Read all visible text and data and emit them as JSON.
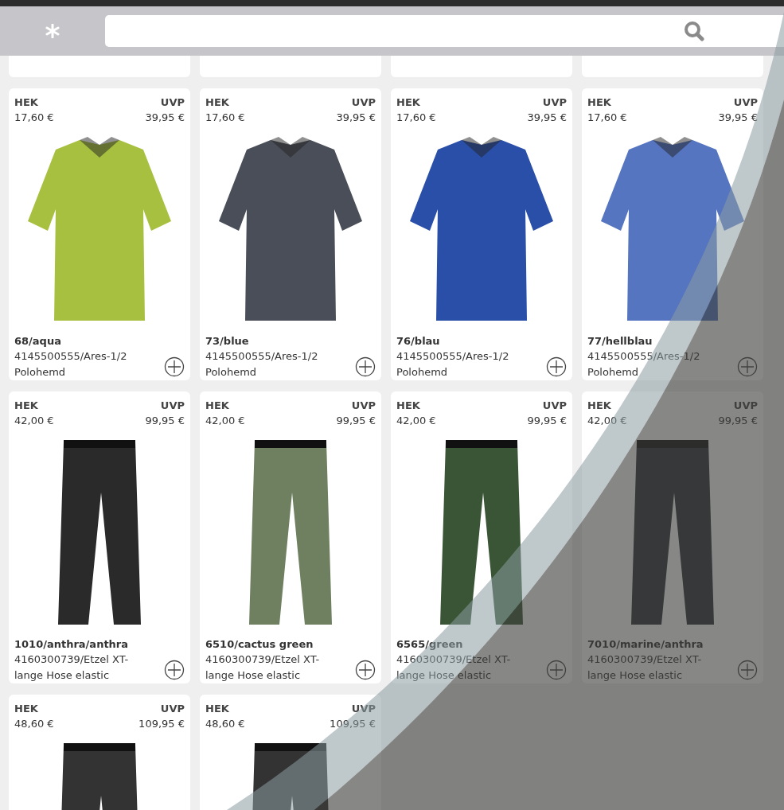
{
  "products": [
    {
      "kind": "partial"
    },
    {
      "kind": "partial"
    },
    {
      "kind": "partial"
    },
    {
      "kind": "partial"
    },
    {
      "kind": "shirt",
      "color": "#a8c040",
      "hek_label": "HEK",
      "hek": "17,60 €",
      "uvp_label": "UVP",
      "uvp": "39,95 €",
      "variant": "68/aqua",
      "model": "4145500555/Ares-1/2",
      "name": "Polohemd"
    },
    {
      "kind": "shirt",
      "color": "#4a4e58",
      "hek_label": "HEK",
      "hek": "17,60 €",
      "uvp_label": "UVP",
      "uvp": "39,95 €",
      "variant": "73/blue",
      "model": "4145500555/Ares-1/2",
      "name": "Polohemd"
    },
    {
      "kind": "shirt",
      "color": "#2a4fa8",
      "hek_label": "HEK",
      "hek": "17,60 €",
      "uvp_label": "UVP",
      "uvp": "39,95 €",
      "variant": "76/blau",
      "model": "4145500555/Ares-1/2",
      "name": "Polohemd"
    },
    {
      "kind": "shirt",
      "color": "#5575c0",
      "hek_label": "HEK",
      "hek": "17,60 €",
      "uvp_label": "UVP",
      "uvp": "39,95 €",
      "variant": "77/hellblau",
      "model": "4145500555/Ares-1/2",
      "name": "Polohemd"
    },
    {
      "kind": "pants",
      "color": "#2a2a2a",
      "hek_label": "HEK",
      "hek": "42,00 €",
      "uvp_label": "UVP",
      "uvp": "99,95 €",
      "variant": "1010/anthra/anthra",
      "model": "4160300739/Etzel XT-",
      "name": "lange Hose elastic"
    },
    {
      "kind": "pants",
      "color": "#6e8060",
      "hek_label": "HEK",
      "hek": "42,00 €",
      "uvp_label": "UVP",
      "uvp": "99,95 €",
      "variant": "6510/cactus green",
      "model": "4160300739/Etzel XT-",
      "name": "lange Hose elastic"
    },
    {
      "kind": "pants",
      "color": "#3a5535",
      "hek_label": "HEK",
      "hek": "42,00 €",
      "uvp_label": "UVP",
      "uvp": "99,95 €",
      "variant": "6565/green",
      "model": "4160300739/Etzel XT-",
      "name": "lange Hose elastic"
    },
    {
      "kind": "pants",
      "color": "#2a2d35",
      "hek_label": "HEK",
      "hek": "42,00 €",
      "uvp_label": "UVP",
      "uvp": "99,95 €",
      "variant": "7010/marine/anthra",
      "model": "4160300739/Etzel XT-",
      "name": "lange Hose elastic"
    },
    {
      "kind": "pants",
      "color": "#333333",
      "hek_label": "HEK",
      "hek": "48,60 €",
      "uvp_label": "UVP",
      "uvp": "109,95 €"
    },
    {
      "kind": "pants",
      "color": "#333333",
      "hek_label": "HEK",
      "hek": "48,60 €",
      "uvp_label": "UVP",
      "uvp": "109,95 €"
    }
  ]
}
